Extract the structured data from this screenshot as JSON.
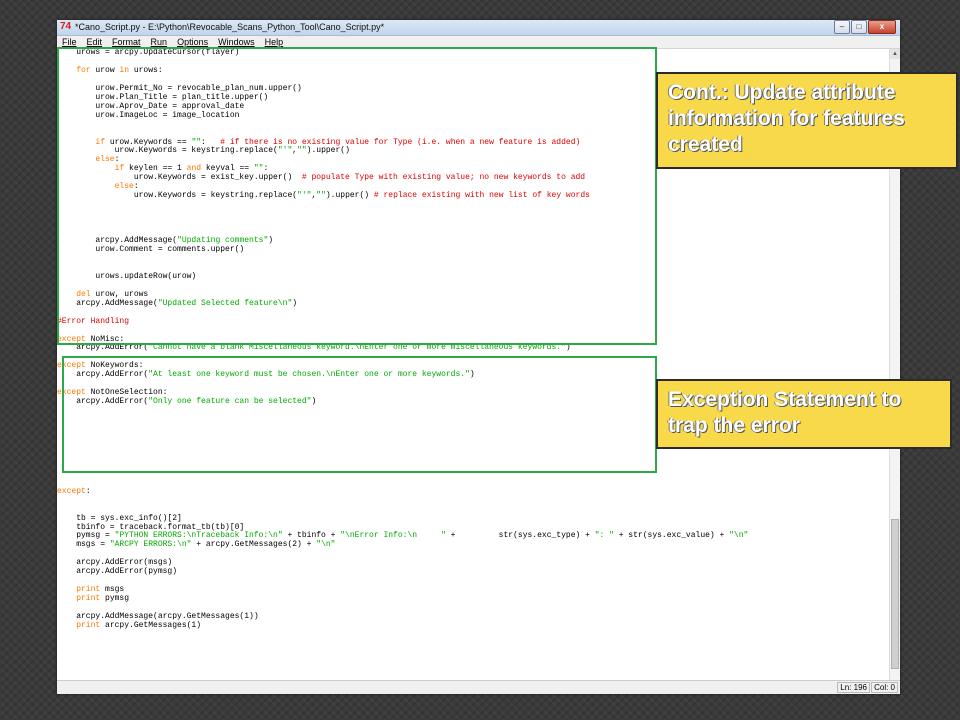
{
  "window": {
    "title": "*Cano_Script.py - E:\\Python\\Revocable_Scans_Python_Tool\\Cano_Script.py*",
    "app_icon": "python-idle-icon",
    "controls": {
      "minimize": "–",
      "maximize": "□",
      "close": "x"
    }
  },
  "menu": [
    "File",
    "Edit",
    "Format",
    "Run",
    "Options",
    "Windows",
    "Help"
  ],
  "code_lines": [
    "    urows = arcpy.UpdateCursor(flayer)",
    "",
    "    for urow in urows:",
    "",
    "        urow.Permit_No = revocable_plan_num.upper()",
    "        urow.Plan_Title = plan_title.upper()",
    "        urow.Aprov_Date = approval_date",
    "        urow.ImageLoc = image_location",
    "",
    "",
    "        if urow.Keywords == \"\":   # if there is no existing value for Type (i.e. when a new feature is added)",
    "            urow.Keywords = keystring.replace(\"'\",\"\").upper()",
    "        else:",
    "            if keylen == 1 and keyval == \"\":",
    "                urow.Keywords = exist_key.upper()  # populate Type with existing value; no new keywords to add",
    "            else:",
    "                urow.Keywords = keystring.replace(\"'\",\"\").upper() # replace existing with new list of key words",
    "",
    "",
    "",
    "",
    "        arcpy.AddMessage(\"Updating comments\")",
    "        urow.Comment = comments.upper()",
    "",
    "",
    "        urows.updateRow(urow)",
    "",
    "    del urow, urows",
    "    arcpy.AddMessage(\"Updated Selected feature\\n\")",
    "",
    "#Error Handling",
    "",
    "except NoMisc:",
    "    arcpy.AddError(\"Cannot have a blank Miscellaneous keyword.\\nEnter one or more miscellaneous keywords.\")",
    "",
    "except NoKeywords:",
    "    arcpy.AddError(\"At least one keyword must be chosen.\\nEnter one or more keywords.\")",
    "",
    "except NotOneSelection:",
    "    arcpy.AddError(\"Only one feature can be selected\")",
    "",
    "",
    "",
    "",
    "",
    "",
    "",
    "",
    "",
    "except:",
    "",
    "",
    "    tb = sys.exc_info()[2]",
    "    tbinfo = traceback.format_tb(tb)[0]",
    "    pymsg = \"PYTHON ERRORS:\\nTraceback Info:\\n\" + tbinfo + \"\\nError Info:\\n     \" +         str(sys.exc_type) + \": \" + str(sys.exc_value) + \"\\n\"",
    "    msgs = \"ARCPY ERRORS:\\n\" + arcpy.GetMessages(2) + \"\\n\"",
    "",
    "    arcpy.AddError(msgs)",
    "    arcpy.AddError(pymsg)",
    "",
    "    print msgs",
    "    print pymsg",
    "",
    "    arcpy.AddMessage(arcpy.GetMessages(1))",
    "    print arcpy.GetMessages(1)"
  ],
  "status": {
    "line": "Ln: 196",
    "col": "Col: 0"
  },
  "callouts": {
    "update": "Cont.: Update attribute information for features created",
    "exception": "Exception Statement to trap the error"
  },
  "colors": {
    "keyword": "#ff7700",
    "string": "#00aa00",
    "comment": "#dd0000",
    "highlight_box": "#2ea84a",
    "callout_bg": "#f7d94a"
  }
}
